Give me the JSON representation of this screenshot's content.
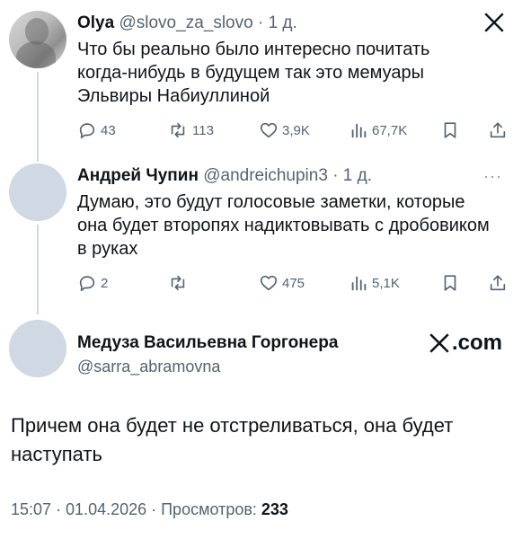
{
  "reply1": {
    "name": "Olya",
    "handle": "@slovo_za_slovo",
    "time": "· 1 д.",
    "text": "Что бы реально было интересно почитать когда-нибудь в будущем так это мемуары Эльвиры Набиуллиной",
    "actions": {
      "replies": "43",
      "retweets": "113",
      "likes": "3,9K",
      "views": "67,7K"
    }
  },
  "reply2": {
    "name": "Андрей Чупин",
    "handle": "@andreichupin3",
    "time": "· 1 д.",
    "more": "···",
    "text": "Думаю, это будут голосовые заметки, которые она будет второпях надиктовывать с дробовиком в руках",
    "actions": {
      "replies": "2",
      "retweets": "",
      "likes": "475",
      "views": "5,1K"
    }
  },
  "main_tweet": {
    "name": "Медуза Васильевна Горгонера",
    "handle": "@sarra_abramovna",
    "brand": ".com",
    "text": "Причем она будет не отстреливаться, она будет наступать",
    "timestamp": "15:07 · 01.04.2026 · Просмотров: ",
    "views": "233"
  },
  "colors": {
    "text": "#0f1419",
    "secondary": "#536471",
    "thread_line": "#cfd9de",
    "avatar_placeholder": "#cfd8e3"
  }
}
